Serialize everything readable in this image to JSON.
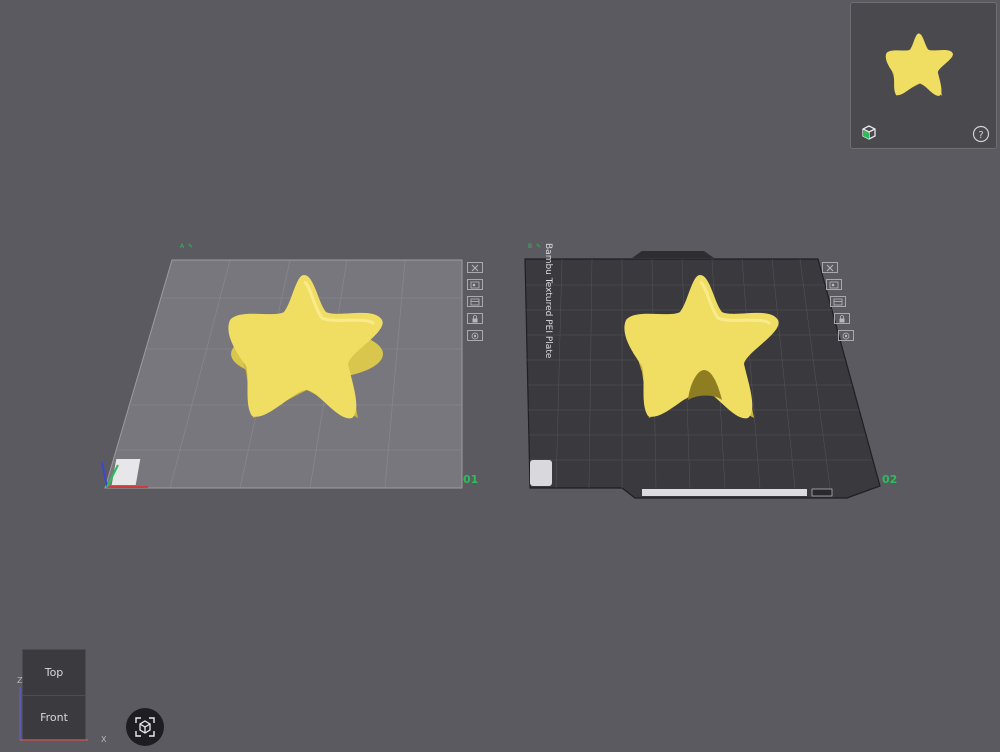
{
  "plates": [
    {
      "label": "A",
      "number": "01",
      "tools": [
        "close-icon",
        "arrange-icon",
        "layout-icon",
        "lock-icon",
        "settings-icon"
      ]
    },
    {
      "label": "B",
      "number": "02",
      "bed_name": "Bambu Textured PEI Plate",
      "tools": [
        "close-icon",
        "arrange-icon",
        "layout-icon",
        "lock-icon",
        "settings-icon"
      ]
    }
  ],
  "viewcube": {
    "top_label": "Top",
    "front_label": "Front"
  },
  "axes": {
    "z_label": "Z",
    "x_label": "X"
  },
  "colors": {
    "background": "#5b5a60",
    "model": "#f0de63",
    "plate_accent": "#2dbd5a",
    "textured_plate": "#3a393e"
  }
}
